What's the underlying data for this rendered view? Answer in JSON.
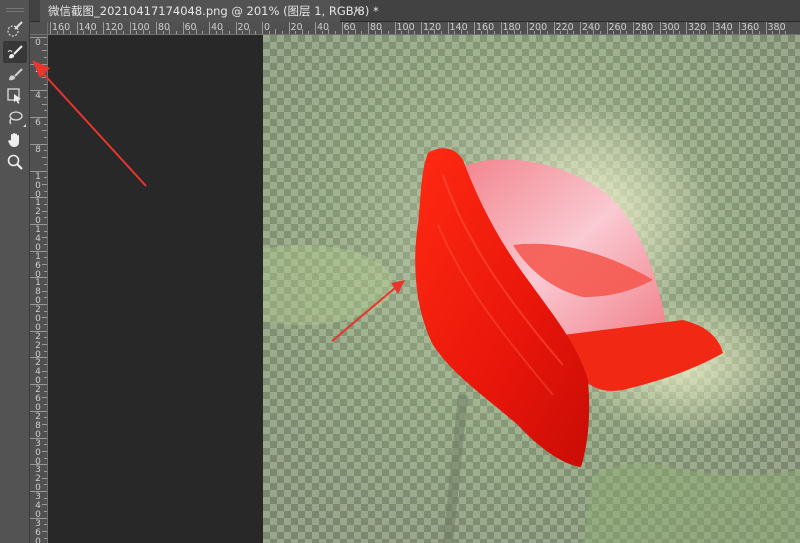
{
  "tab": {
    "title": "微信截图_20210417174048.png @ 201% (图层 1, RGB/8) *",
    "close_symbol": "✕"
  },
  "ruler_h": {
    "labels": [
      "160",
      "140",
      "120",
      "100",
      "80",
      "60",
      "40",
      "20",
      "0",
      "20",
      "40",
      "60",
      "80",
      "100",
      "120",
      "140",
      "160",
      "180",
      "200",
      "220",
      "240",
      "260",
      "280",
      "300",
      "320",
      "340",
      "360",
      "380"
    ]
  },
  "ruler_v": {
    "labels": [
      "0",
      "2",
      "4",
      "6",
      "8",
      "100",
      "120",
      "140",
      "160",
      "180",
      "200",
      "220",
      "240",
      "260",
      "280",
      "300",
      "320",
      "340",
      "360"
    ]
  },
  "toolbar": {
    "tools": [
      {
        "name": "quick-selection-icon"
      },
      {
        "name": "brush-icon"
      },
      {
        "name": "eraser-icon"
      },
      {
        "name": "move-selection-icon"
      },
      {
        "name": "lasso-icon"
      },
      {
        "name": "hand-icon"
      },
      {
        "name": "zoom-icon"
      }
    ]
  },
  "colors": {
    "annotation_arrow": "#e8352e",
    "flower_red": "#f21e0c",
    "petal_pink": "#f6a6ae"
  }
}
